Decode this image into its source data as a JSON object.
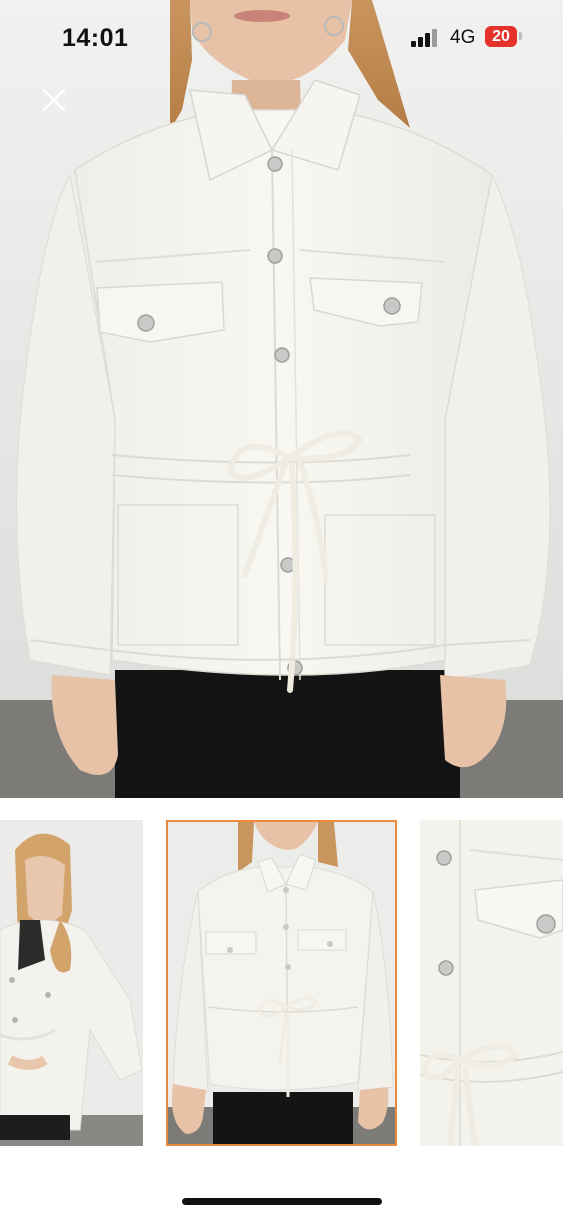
{
  "status_bar": {
    "time": "14:01",
    "network": "4G",
    "battery": "20",
    "battery_color": "#e5322b"
  },
  "viewer": {
    "close_icon": "close-icon",
    "main_image": "white-utility-jacket-front-view",
    "thumbnails": [
      {
        "image": "model-side-view",
        "selected": false
      },
      {
        "image": "jacket-front-view",
        "selected": true
      },
      {
        "image": "jacket-pocket-detail",
        "selected": false
      }
    ],
    "selected_border_color": "#e98a3c"
  }
}
